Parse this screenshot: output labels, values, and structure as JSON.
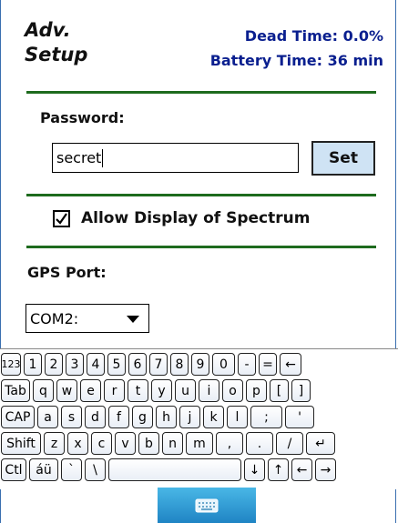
{
  "header": {
    "title_line1": "Adv.",
    "title_line2": "Setup",
    "dead_time": "Dead Time: 0.0%",
    "battery_time": "Battery Time: 36 min"
  },
  "password": {
    "label": "Password:",
    "value": "secret",
    "set_label": "Set"
  },
  "spectrum": {
    "checked": true,
    "label": "Allow Display of Spectrum"
  },
  "gps": {
    "label": "GPS Port:",
    "selected": "COM2:"
  },
  "keyboard": {
    "rows": [
      [
        "123",
        "1",
        "2",
        "3",
        "4",
        "5",
        "6",
        "7",
        "8",
        "9",
        "0",
        "-",
        "=",
        "←"
      ],
      [
        "Tab",
        "q",
        "w",
        "e",
        "r",
        "t",
        "y",
        "u",
        "i",
        "o",
        "p",
        "[",
        "]"
      ],
      [
        "CAP",
        "a",
        "s",
        "d",
        "f",
        "g",
        "h",
        "j",
        "k",
        "l",
        ";",
        "'"
      ],
      [
        "Shift",
        "z",
        "x",
        "c",
        "v",
        "b",
        "n",
        "m",
        ",",
        ".",
        "/",
        "↵"
      ],
      [
        "Ctl",
        "áü",
        "`",
        "\\",
        "",
        "↓",
        "↑",
        "←",
        "→"
      ]
    ]
  },
  "colors": {
    "title_blue": "#0a1f8f",
    "divider_green": "#1e6b1e",
    "set_button_bg": "#cfe3f4",
    "toggle_blue": "#1f84c4"
  }
}
